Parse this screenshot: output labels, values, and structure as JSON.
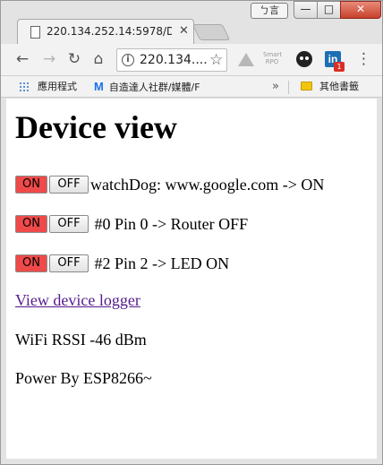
{
  "window": {
    "user_badge": "ㄅ言",
    "minimize": "—",
    "maximize": "□",
    "close": "✕"
  },
  "tab": {
    "title": "220.134.252.14:5978/D",
    "close": "✕"
  },
  "toolbar": {
    "back_icon": "←",
    "forward_icon": "→",
    "reload_icon": "↻",
    "home_icon": "⌂",
    "url": "220.134....",
    "info_icon": "i",
    "star_icon": "☆",
    "smart_label": "Smart\nRPO",
    "linkedin_label": "in",
    "badge_count": "1",
    "menu_icon": "⋮"
  },
  "bookmarks": {
    "apps_label": "應用程式",
    "m_logo": "M",
    "m_label": "自造達人社群/媒體/F",
    "more": "»",
    "other_label": "其他書籤"
  },
  "page": {
    "heading": "Device view",
    "on_label": "ON",
    "off_label": "OFF",
    "rows": [
      {
        "on": "ON",
        "off": "OFF",
        "text": "watchDog: www.google.com -> ON"
      },
      {
        "on": "ON",
        "off": "OFF",
        "text": " #0 Pin 0 -> Router OFF"
      },
      {
        "on": "ON",
        "off": "OFF",
        "text": " #2 Pin 2 -> LED ON"
      }
    ],
    "logger_link": "View device logger",
    "rssi": "WiFi RSSI -46 dBm",
    "powered": "Power By ESP8266~"
  },
  "colors": {
    "on_button": "#ef4a4a",
    "link": "#551a8b",
    "chrome_frame": "#e3e3e3"
  }
}
